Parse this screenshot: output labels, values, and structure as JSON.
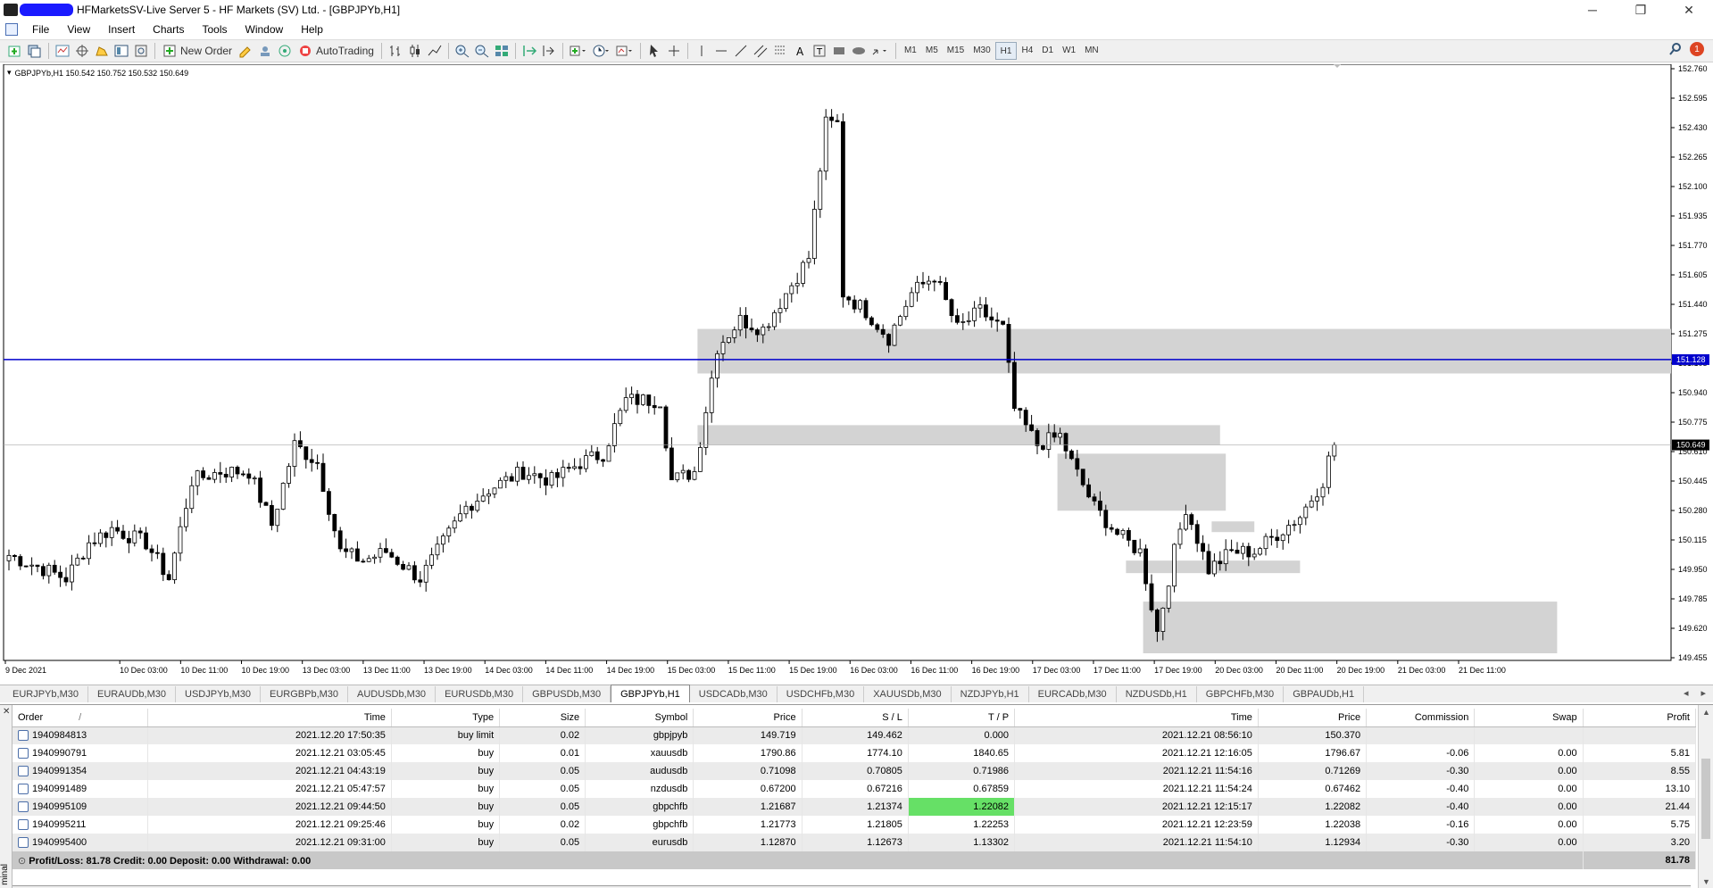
{
  "window": {
    "title": "HFMarketsSV-Live Server 5 - HF Markets (SV) Ltd. - [GBPJPYb,H1]",
    "minimize_icon": "─",
    "restore_icon": "❐",
    "close_icon": "✕"
  },
  "menu": [
    "File",
    "View",
    "Insert",
    "Charts",
    "Tools",
    "Window",
    "Help"
  ],
  "toolbar": {
    "new_order_label": "New Order",
    "autotrading_label": "AutoTrading",
    "timeframes": [
      "M1",
      "M5",
      "M15",
      "M30",
      "H1",
      "H4",
      "D1",
      "W1",
      "MN"
    ],
    "active_timeframe": "H1",
    "alert_count": "1"
  },
  "chart_data": {
    "type": "candlestick",
    "symbol_header": "GBPJPYb,H1  150.542 150.752 150.532 150.649",
    "price_ticks": [
      "152.760",
      "152.595",
      "152.430",
      "152.265",
      "152.100",
      "151.935",
      "151.770",
      "151.605",
      "151.440",
      "151.275",
      "151.105",
      "150.940",
      "150.775",
      "150.610",
      "150.445",
      "150.280",
      "150.115",
      "149.950",
      "149.785",
      "149.620",
      "149.455"
    ],
    "ylim": [
      149.455,
      152.76
    ],
    "time_ticks": [
      "9 Dec 2021",
      "10 Dec 03:00",
      "10 Dec 11:00",
      "10 Dec 19:00",
      "13 Dec 03:00",
      "13 Dec 11:00",
      "13 Dec 19:00",
      "14 Dec 03:00",
      "14 Dec 11:00",
      "14 Dec 19:00",
      "15 Dec 03:00",
      "15 Dec 11:00",
      "15 Dec 19:00",
      "16 Dec 03:00",
      "16 Dec 11:00",
      "16 Dec 19:00",
      "17 Dec 03:00",
      "17 Dec 11:00",
      "17 Dec 19:00",
      "20 Dec 03:00",
      "20 Dec 11:00",
      "20 Dec 19:00",
      "21 Dec 03:00",
      "21 Dec 11:00"
    ],
    "hline_price": 151.128,
    "hline_label": "151.128",
    "hline_color": "#0000cc",
    "current_price": 150.649,
    "current_price_label": "150.649",
    "zones": [
      {
        "from_bar": 121,
        "to_bar": 0,
        "hi": 151.3,
        "lo": 151.05
      },
      {
        "from_bar": 121,
        "to_bar": 212,
        "hi": 150.76,
        "lo": 150.65
      },
      {
        "from_bar": 184,
        "to_bar": 213,
        "hi": 150.6,
        "lo": 150.28
      },
      {
        "from_bar": 211,
        "to_bar": 218,
        "hi": 150.22,
        "lo": 150.16
      },
      {
        "from_bar": 196,
        "to_bar": 226,
        "hi": 150.0,
        "lo": 149.93
      },
      {
        "from_bar": 199,
        "to_bar": 271,
        "hi": 149.77,
        "lo": 149.48
      }
    ],
    "up_color": "#ffffff",
    "down_color": "#000000",
    "zone_color": "#d3d3d3",
    "anchors": [
      [
        0,
        150.03
      ],
      [
        4,
        149.98
      ],
      [
        10,
        149.9
      ],
      [
        14,
        150.1
      ],
      [
        18,
        150.18
      ],
      [
        24,
        150.1
      ],
      [
        28,
        149.9
      ],
      [
        32,
        150.45
      ],
      [
        37,
        150.5
      ],
      [
        42,
        150.5
      ],
      [
        46,
        150.2
      ],
      [
        50,
        150.65
      ],
      [
        54,
        150.55
      ],
      [
        58,
        150.05
      ],
      [
        62,
        150.0
      ],
      [
        66,
        150.05
      ],
      [
        72,
        149.9
      ],
      [
        76,
        150.1
      ],
      [
        80,
        150.3
      ],
      [
        84,
        150.4
      ],
      [
        90,
        150.5
      ],
      [
        95,
        150.45
      ],
      [
        100,
        150.55
      ],
      [
        104,
        150.6
      ],
      [
        108,
        150.9
      ],
      [
        114,
        150.9
      ],
      [
        116,
        150.45
      ],
      [
        120,
        150.5
      ],
      [
        124,
        151.2
      ],
      [
        128,
        151.35
      ],
      [
        132,
        151.3
      ],
      [
        136,
        151.5
      ],
      [
        140,
        151.7
      ],
      [
        143,
        152.45
      ],
      [
        145,
        152.45
      ],
      [
        146,
        151.5
      ],
      [
        150,
        151.4
      ],
      [
        154,
        151.25
      ],
      [
        158,
        151.5
      ],
      [
        162,
        151.6
      ],
      [
        166,
        151.3
      ],
      [
        170,
        151.4
      ],
      [
        174,
        151.3
      ],
      [
        176,
        150.85
      ],
      [
        180,
        150.65
      ],
      [
        184,
        150.7
      ],
      [
        186,
        150.55
      ],
      [
        190,
        150.3
      ],
      [
        194,
        150.15
      ],
      [
        198,
        150.05
      ],
      [
        201,
        149.6
      ],
      [
        204,
        150.05
      ],
      [
        206,
        150.3
      ],
      [
        210,
        149.95
      ],
      [
        214,
        150.05
      ],
      [
        218,
        150.05
      ],
      [
        222,
        150.15
      ],
      [
        226,
        150.25
      ],
      [
        230,
        150.45
      ],
      [
        232,
        150.68
      ]
    ]
  },
  "symbol_tabs": [
    "EURJPYb,M30",
    "EURAUDb,M30",
    "USDJPYb,M30",
    "EURGBPb,M30",
    "AUDUSDb,M30",
    "EURUSDb,M30",
    "GBPUSDb,M30",
    "GBPJPYb,H1",
    "USDCADb,M30",
    "USDCHFb,M30",
    "XAUUSDb,M30",
    "NZDJPYb,H1",
    "EURCADb,M30",
    "NZDUSDb,H1",
    "GBPCHFb,M30",
    "GBPAUDb,H1"
  ],
  "active_tab": "GBPJPYb,H1",
  "terminal": {
    "side_label": "minal",
    "columns": [
      "Order",
      "Time",
      "Type",
      "Size",
      "Symbol",
      "Price",
      "S / L",
      "T / P",
      "Time",
      "Price",
      "Commission",
      "Swap",
      "Profit"
    ],
    "order_sort_indicator": "/",
    "rows": [
      {
        "order": "1940984813",
        "time": "2021.12.20 17:50:35",
        "type": "buy limit",
        "size": "0.02",
        "symbol": "gbpjpyb",
        "price": "149.719",
        "sl": "149.462",
        "tp": "0.000",
        "time2": "2021.12.21 08:56:10",
        "price2": "150.370",
        "commission": "",
        "swap": "",
        "profit": ""
      },
      {
        "order": "1940990791",
        "time": "2021.12.21 03:05:45",
        "type": "buy",
        "size": "0.01",
        "symbol": "xauusdb",
        "price": "1790.86",
        "sl": "1774.10",
        "tp": "1840.65",
        "time2": "2021.12.21 12:16:05",
        "price2": "1796.67",
        "commission": "-0.06",
        "swap": "0.00",
        "profit": "5.81"
      },
      {
        "order": "1940991354",
        "time": "2021.12.21 04:43:19",
        "type": "buy",
        "size": "0.05",
        "symbol": "audusdb",
        "price": "0.71098",
        "sl": "0.70805",
        "tp": "0.71986",
        "time2": "2021.12.21 11:54:16",
        "price2": "0.71269",
        "commission": "-0.30",
        "swap": "0.00",
        "profit": "8.55"
      },
      {
        "order": "1940991489",
        "time": "2021.12.21 05:47:57",
        "type": "buy",
        "size": "0.05",
        "symbol": "nzdusdb",
        "price": "0.67200",
        "sl": "0.67216",
        "tp": "0.67859",
        "time2": "2021.12.21 11:54:24",
        "price2": "0.67462",
        "commission": "-0.40",
        "swap": "0.00",
        "profit": "13.10"
      },
      {
        "order": "1940995109",
        "time": "2021.12.21 09:44:50",
        "type": "buy",
        "size": "0.05",
        "symbol": "gbpchfb",
        "price": "1.21687",
        "sl": "1.21374",
        "tp": "1.22082",
        "time2": "2021.12.21 12:15:17",
        "price2": "1.22082",
        "commission": "-0.40",
        "swap": "0.00",
        "profit": "21.44",
        "tp_hit": true
      },
      {
        "order": "1940995211",
        "time": "2021.12.21 09:25:46",
        "type": "buy",
        "size": "0.02",
        "symbol": "gbpchfb",
        "price": "1.21773",
        "sl": "1.21805",
        "tp": "1.22253",
        "time2": "2021.12.21 12:23:59",
        "price2": "1.22038",
        "commission": "-0.16",
        "swap": "0.00",
        "profit": "5.75"
      },
      {
        "order": "1940995400",
        "time": "2021.12.21 09:31:00",
        "type": "buy",
        "size": "0.05",
        "symbol": "eurusdb",
        "price": "1.12870",
        "sl": "1.12673",
        "tp": "1.13302",
        "time2": "2021.12.21 11:54:10",
        "price2": "1.12934",
        "commission": "-0.30",
        "swap": "0.00",
        "profit": "3.20"
      }
    ],
    "summary": "Profit/Loss: 81.78  Credit: 0.00  Deposit: 0.00  Withdrawal: 0.00",
    "total": "81.78"
  }
}
